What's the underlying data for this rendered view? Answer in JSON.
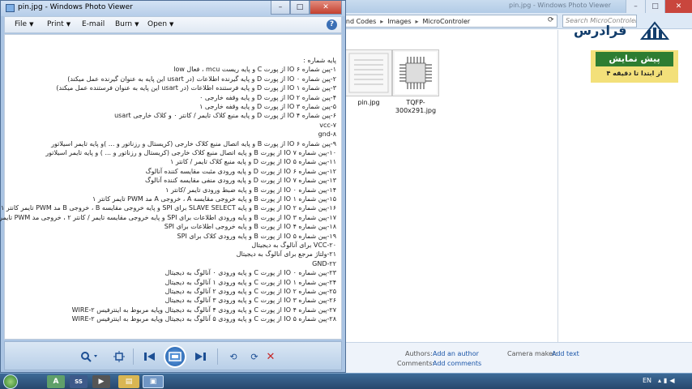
{
  "viewer": {
    "title": "pin.jpg - Windows Photo Viewer",
    "window_buttons": {
      "minimize": "–",
      "maximize": "□",
      "close": "✕"
    },
    "menu": {
      "file": "File",
      "print": "Print",
      "email": "E-mail",
      "burn": "Burn",
      "open": "Open",
      "help": "?"
    },
    "image_text": [
      "پایه شماره :",
      "۱-پین شماره ۶ IO از پورت C و پایه ریست mcu ، فعال low",
      "۲-پین شماره ۰ IO از پورت D و پایه گیرنده اطلاعات (در usart این پایه به عنوان گیرنده عمل میکند)",
      "۳-پین شماره ۱ IO از پورت D و پایه فرستنده اطلاعات (در usart این پایه به عنوان فرستنده عمل میکند)",
      "۴-پین شماره ۲ IO از پورت D و پایه وقفه خارجی ۰",
      "۵-پین شماره ۳ IO از پورت D و پایه وقفه خارجی ۱",
      "۶-پین شماره ۴ IO از پورت D و پایه منبع کلاک تایمر / کانتر ۰ و کلاک خارجی usart",
      "vcc-۷",
      "gnd-۸",
      "۹-پین شماره ۶ IO از پورت B و پایه اتصال منبع کلاک خارجی (کریستال و رزناتور و ... )و پایه تایمر اسیلاتور",
      "۱۰-پین شماره ۷ IO از پورت B و پایه اتصال منبع کلاک خارجی (کریستال و رزناتور و ... ) و پایه تایمر اسیلاتور",
      "۱۱-پین شماره ۵ IO از پورت D و پایه منبع کلاک تایمر / کانتر ۱",
      "۱۲-پین شماره ۶ IO از پورت D و پایه ورودی مثبت مقایسه کننده آنالوگ",
      "۱۳-پین شماره ۷ IO از پورت D و پایه ورودی منفی مقایسه کننده آنالوگ",
      "۱۴-پین شماره ۰ IO از پورت B و پایه ضبط ورودی تایمر /کانتر ۱",
      "۱۵-پین شماره ۱ IO از پورت B و پایه خروجی مقایسه A ، خروجی A مد PWM تایمر کانتر ۱",
      "۱۶-پین شماره ۲ IO از پورت B و پایه SLAVE SELECT برای SPI و پایه خروجی مقایسه B ، خروجی B مد PWM تایمر کانتر ۱",
      "۱۷-پین شماره ۳ IO از پورت B و پایه ورودی اطلاعات برای SPI و پایه خروجی مقایسه تایمر / کانتر ۲ ، خروجی مد PWM تایمر کانتر ۲",
      "۱۸-پین شماره ۴ IO از پورت B و پایه خروجی اطلاعات برای SPI",
      "۱۹-پین شماره ۵ IO از پورت B و پایه ورودی کلاک برای SPI",
      "VCC-۲۰ برای آنالوگ به دیجیتال",
      "۲۱-ولتاژ مرجع برای آنالوگ به دیجیتال",
      "GND-۲۲",
      "۲۳-پین شماره ۰ IO از پورت C و پایه ورودی ۰ آنالوگ به دیجیتال",
      "۲۴-پین شماره ۱ IO از پورت C و پایه ورودی ۱ آنالوگ به دیجیتال",
      "۲۵-پین شماره ۲ IO از پورت C و پایه ورودی ۲ آنالوگ به دیجیتال",
      "۲۶-پین شماره ۳ IO از پورت C و پایه ورودی ۳ آنالوگ به دیجیتال",
      "۲۷-پین شماره ۴ IO از پورت C و پایه ورودی ۴ آنالوگ به دیجیتال وپایه مربوط به اینترفیس WIRE-۲",
      "۲۸-پین شماره ۵ IO از پورت C و پایه ورودی ۵ آنالوگ به دیجیتال وپایه مربوط به اینترفیس WIRE-۲"
    ],
    "toolbar_icons": {
      "zoom": "zoom-icon",
      "fit": "actual-size-icon",
      "prev": "previous-icon",
      "slideshow": "slideshow-icon",
      "next": "next-icon",
      "rotate_left": "rotate-left-icon",
      "rotate_right": "rotate-right-icon",
      "delete": "delete-icon"
    }
  },
  "explorer": {
    "title": "pin.jpg - Windows Photo Viewer",
    "breadcrumb": [
      "and Codes",
      "Images",
      "MicroControler"
    ],
    "search_placeholder": "Search MicroControler",
    "files": [
      {
        "name": "pin.jpg"
      },
      {
        "name": "TQFP-300x291.jpg"
      }
    ],
    "logo_text": "فرادرس",
    "ad": {
      "title": "پیش نمایش",
      "subtitle": "از ابتدا تا دقیقه ۴"
    },
    "details": {
      "authors_label": "Authors:",
      "authors_value": "Add an author",
      "comments_label": "Comments:",
      "comments_value": "Add comments",
      "camera_label": "Camera maker:",
      "camera_value": "Add text"
    }
  },
  "taskbar": {
    "apps": [
      "A",
      "SS"
    ],
    "language": "EN"
  }
}
